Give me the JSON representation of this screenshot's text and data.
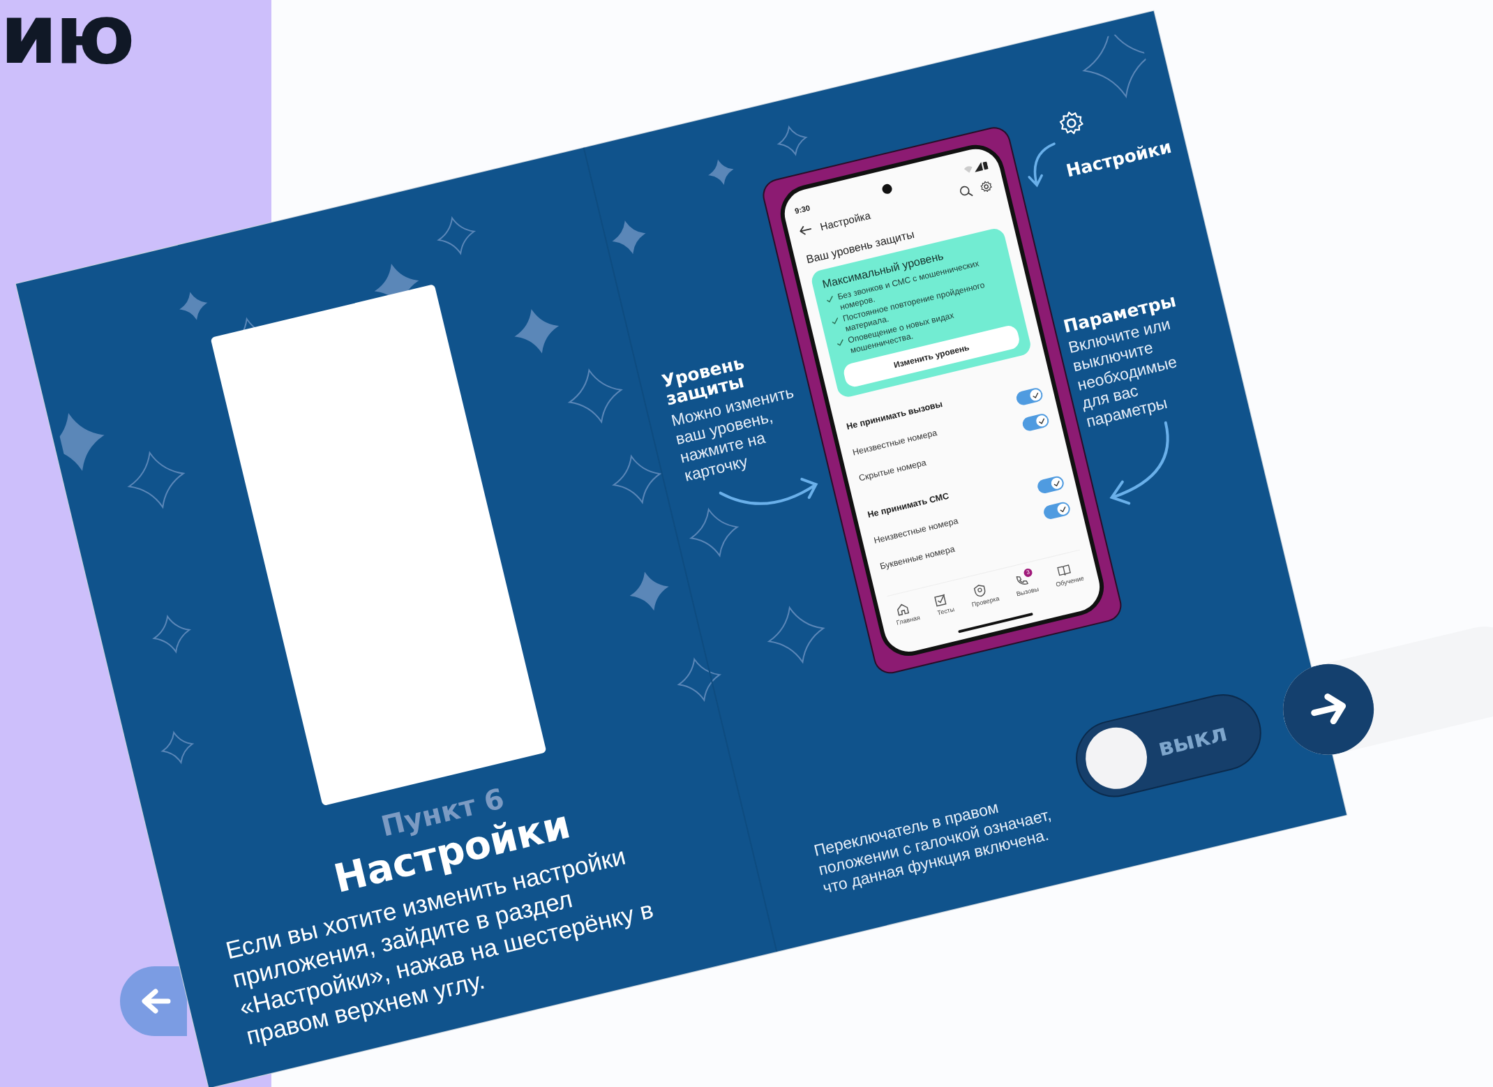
{
  "side_strip": {
    "heading_fragment": "ию"
  },
  "booklet": {
    "left_page": {
      "step": "Пункт 6",
      "title": "Настройки",
      "text": "Если вы хотите изменить настройки приложения, зайдите в раздел «Настройки», нажав на шестерёнку в правом верхнем углу."
    },
    "annotations": [
      {
        "kind": "level",
        "title": "Уровень защиты",
        "text": "Можно изменить ваш уровень, нажмите на карточку"
      },
      {
        "kind": "settings",
        "title": "Настройки"
      },
      {
        "kind": "params",
        "title": "Параметры",
        "text": "Включите или выключите необходимые для вас параметры"
      }
    ],
    "phone": {
      "time": "9:30",
      "title": "Настройка",
      "section": "Ваш уровень защиты",
      "card": {
        "title": "Максимальный уровень",
        "bullets": [
          "Без звонков и СМС с мошеннических номеров.",
          "Постоянное повторение пройденного материала.",
          "Оповещение о новых видах мошенничества."
        ],
        "button": "Изменить уровень"
      },
      "rows": [
        {
          "kind": "group",
          "label": "Не принимать вызовы",
          "on": true
        },
        {
          "kind": "option",
          "label": "Неизвестные номера",
          "on": true
        },
        {
          "kind": "option",
          "label": "Скрытые номера"
        },
        {
          "kind": "group",
          "label": "Не принимать СМС",
          "on": true
        },
        {
          "kind": "option",
          "label": "Неизвестные номера",
          "on": true
        },
        {
          "kind": "option",
          "label": "Буквенные номера"
        }
      ],
      "nav": [
        {
          "kind": "home",
          "label": "Главная"
        },
        {
          "kind": "tests",
          "label": "Тесты"
        },
        {
          "kind": "check",
          "label": "Проверка"
        },
        {
          "kind": "calls",
          "label": "Вызовы",
          "badge": "3"
        },
        {
          "kind": "learn",
          "label": "Обучение"
        }
      ]
    },
    "switch_demo": {
      "caption": "Переключатель в правом положении с галочкой означает, что данная функция включена.",
      "label": "выкл",
      "on": false
    }
  }
}
